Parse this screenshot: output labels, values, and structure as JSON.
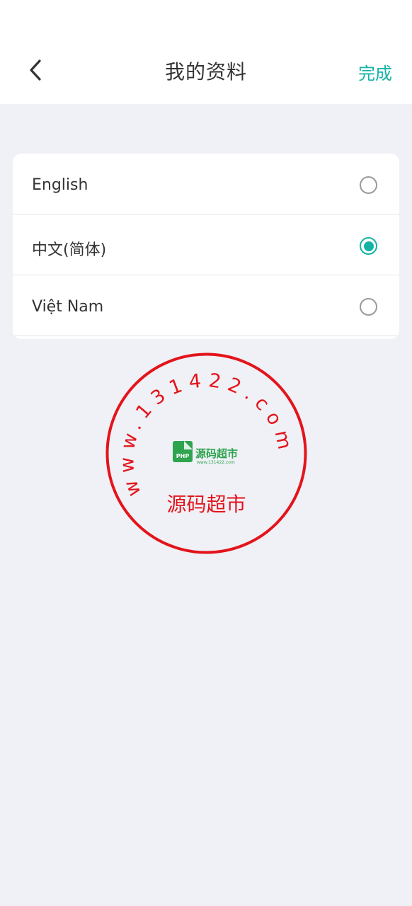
{
  "header": {
    "title": "我的资料",
    "done_label": "完成"
  },
  "languages": [
    {
      "label": "English",
      "selected": false
    },
    {
      "label": "中文(简体)",
      "selected": true
    },
    {
      "label": "Việt Nam",
      "selected": false
    }
  ],
  "watermark": {
    "ring_text": "www.131422.com",
    "center_text": "源码超市",
    "logo_title": "源码超市",
    "logo_badge": "PHP",
    "logo_url": "www.131422.com",
    "color": "#e3141b"
  },
  "colors": {
    "accent": "#14b3a6",
    "background": "#f0f1f6",
    "text": "#333333"
  }
}
